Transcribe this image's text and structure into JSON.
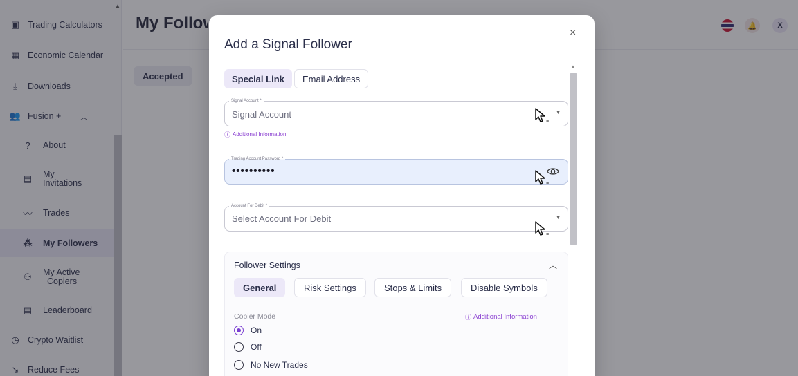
{
  "sidebar": {
    "items": [
      {
        "label": "Trading Calculators",
        "icon": "calculator-icon"
      },
      {
        "label": "Economic Calendar",
        "icon": "calendar-icon"
      },
      {
        "label": "Downloads",
        "icon": "download-icon"
      },
      {
        "label": "Fusion +",
        "icon": "users-icon"
      },
      {
        "label": "About",
        "icon": "question-icon"
      },
      {
        "label": "My Invitations",
        "icon": "ticket-icon"
      },
      {
        "label": "Trades",
        "icon": "trend-icon"
      },
      {
        "label": "My Followers",
        "icon": "followers-icon"
      },
      {
        "label": "My Active Copiers",
        "icon": "copiers-icon"
      },
      {
        "label": "Leaderboard",
        "icon": "leaderboard-icon"
      },
      {
        "label": "Crypto Waitlist",
        "icon": "clock-icon"
      },
      {
        "label": "Reduce Fees",
        "icon": "trend-down-icon"
      }
    ],
    "invitations_line1": "My",
    "invitations_line2": "Invitations",
    "copiers_line1": "My Active",
    "copiers_line2": "Copiers"
  },
  "header": {
    "title": "My Followers",
    "avatar": "X",
    "flag": "thailand-flag"
  },
  "background_tab": "Accepted",
  "modal": {
    "title": "Add a Signal Follower",
    "close": "×",
    "segments": [
      "Special Link",
      "Email Address"
    ],
    "signal_account": {
      "label": "Signal Account *",
      "placeholder": "Signal Account"
    },
    "additional_info": "Additional Information",
    "password": {
      "label": "Trading Account Password *",
      "value": "••••••••••"
    },
    "debit_account": {
      "label": "Account For Debit *",
      "placeholder": "Select Account For Debit"
    },
    "settings": {
      "title": "Follower Settings",
      "tabs": [
        "General",
        "Risk Settings",
        "Stops & Limits",
        "Disable Symbols"
      ],
      "copier_mode_label": "Copier Mode",
      "additional_info": "Additional Information",
      "options": [
        "On",
        "Off",
        "No New Trades"
      ],
      "selected": "On"
    }
  },
  "colors": {
    "accent": "#7a3fd1",
    "sidebar_active": "#e9e6f6",
    "filled_field": "#e8effd"
  }
}
